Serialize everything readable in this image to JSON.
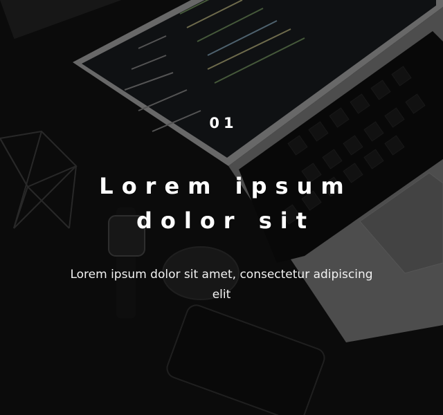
{
  "slide": {
    "number": "01",
    "title_line1": "Lorem ipsum",
    "title_line2": "dolor sit",
    "description": "Lorem ipsum dolor sit amet, consectetur adipiscing elit"
  },
  "background": {
    "subject": "laptop with code editor, keyboard, smartwatch, mouse and smartphone on dark desk",
    "overlay_color": "#000000"
  }
}
